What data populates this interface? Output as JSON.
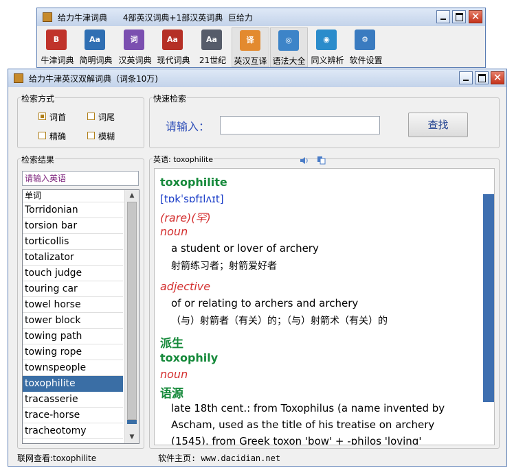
{
  "top_window": {
    "title": "给力牛津词典      4部英汉词典+1部汉英词典  巨给力",
    "toolbar": [
      {
        "label": "牛津词典",
        "icon": "book-red-icon",
        "color": "#c0332b",
        "glyph": "B"
      },
      {
        "label": "简明词典",
        "icon": "book-aa-icon",
        "color": "#2f6fb3",
        "glyph": "Aa"
      },
      {
        "label": "汉英词典",
        "icon": "book-purple-icon",
        "color": "#7b4fb0",
        "glyph": "词"
      },
      {
        "label": "现代词典",
        "icon": "book-aa-red-icon",
        "color": "#b53026",
        "glyph": "Aa"
      },
      {
        "label": "21世纪",
        "icon": "book-aa-gray-icon",
        "color": "#565c6a",
        "glyph": "Aa"
      },
      {
        "label": "英汉互译",
        "icon": "translate-icon",
        "color": "#e38a2f",
        "glyph": "译"
      },
      {
        "label": "语法大全",
        "icon": "compass-icon",
        "color": "#3d84c8",
        "glyph": "◎"
      },
      {
        "label": "同义辨析",
        "icon": "globe-book-icon",
        "color": "#2b8ccb",
        "glyph": "◉"
      },
      {
        "label": "软件设置",
        "icon": "gear-icon",
        "color": "#3a7bc0",
        "glyph": "⚙"
      }
    ]
  },
  "main_window": {
    "title": "给力牛津英汉双解词典（词条10万)",
    "search_mode": {
      "label": "检索方式",
      "options": [
        {
          "label": "词首",
          "checked": true
        },
        {
          "label": "词尾",
          "checked": false
        },
        {
          "label": "精确",
          "checked": false
        },
        {
          "label": "模糊",
          "checked": false
        }
      ]
    },
    "quick_search": {
      "label": "快速检索",
      "prompt": "请输入：",
      "value": "",
      "button": "查找"
    },
    "results": {
      "label": "检索结果",
      "input_value": "请输入英语",
      "column": "单词",
      "items": [
        "Torridonian",
        "torsion bar",
        "torticollis",
        "totalizator",
        "touch judge",
        "touring car",
        "towel horse",
        "tower block",
        "towing path",
        "towing rope",
        "townspeople",
        "toxophilite",
        "tracasserie",
        "trace-horse",
        "tracheotomy"
      ],
      "selected": "toxophilite"
    },
    "entry": {
      "header_label": "英语: toxophilite",
      "speaker_icon": "speaker-icon",
      "copy_icon": "copy-icon",
      "headword": "toxophilite",
      "pronunciation": "[tɒkˈsɒfɪlʌɪt]",
      "register": "(rare)(罕)",
      "senses": [
        {
          "pos": "noun",
          "en": "a student or lover of archery",
          "zh": "射箭练习者；射箭爱好者"
        },
        {
          "pos": "adjective",
          "en": "of or relating to archers and archery",
          "zh": "（与）射箭者（有关）的；（与）射箭术（有关）的"
        }
      ],
      "derivative_heading": "派生",
      "derivative_word": "toxophily",
      "derivative_pos": "noun",
      "etymology_heading": "语源",
      "etymology_lines": [
        "late 18th cent.: from Toxophilus (a name invented by",
        "Ascham, used as the title of his treatise on archery",
        "(1545), from Greek toxon 'bow' + -philos 'loving'"
      ]
    },
    "status": {
      "left": "联网查看:toxophilite",
      "right": "软件主页: www.dacidian.net"
    }
  }
}
